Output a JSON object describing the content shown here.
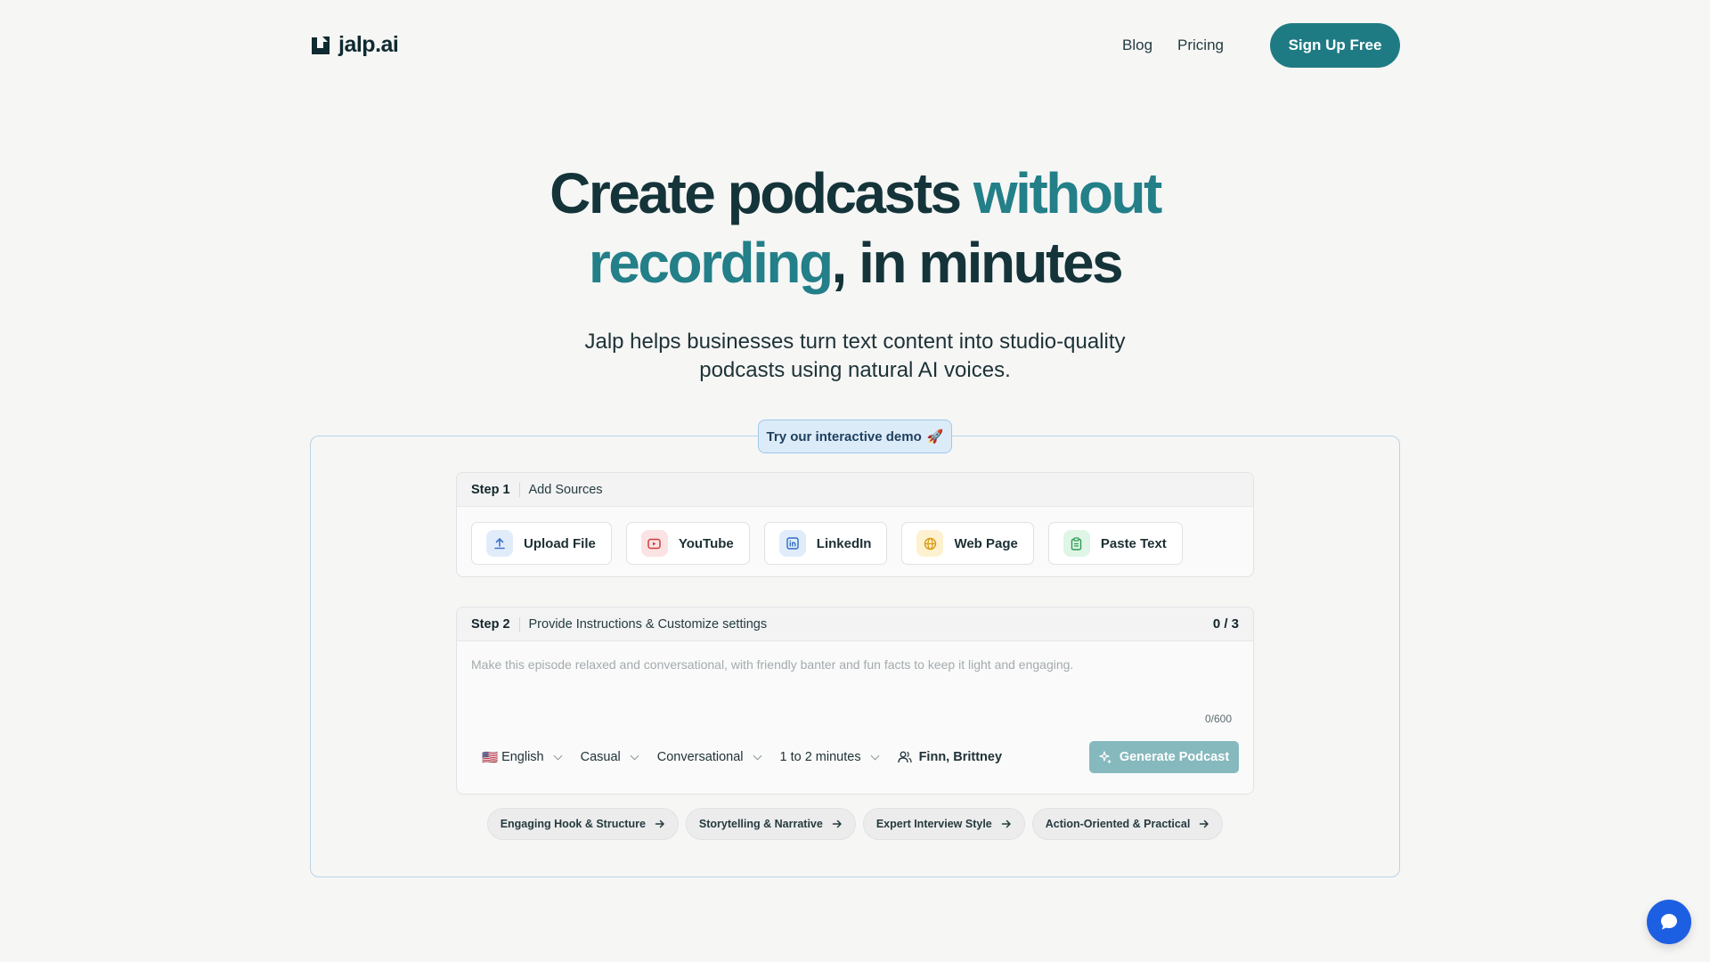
{
  "brand": {
    "name": "jalp.ai"
  },
  "nav": {
    "blog": "Blog",
    "pricing": "Pricing",
    "signup": "Sign Up Free"
  },
  "hero": {
    "title_part1": "Create podcasts ",
    "title_accent_line1": "without",
    "title_accent_line2": "recording",
    "title_part2": ", in minutes",
    "subtitle": "Jalp helps businesses turn text content into studio-quality podcasts using natural AI voices."
  },
  "demo": {
    "label": "Try our interactive demo",
    "emoji": "🚀"
  },
  "step1": {
    "num": "Step 1",
    "title": "Add Sources",
    "sources": [
      {
        "label": "Upload File",
        "icon": "upload-icon",
        "bg": "#e1ecfb",
        "color": "#3f74c9"
      },
      {
        "label": "YouTube",
        "icon": "youtube-icon",
        "bg": "#fbe3e3",
        "color": "#d23b3b"
      },
      {
        "label": "LinkedIn",
        "icon": "linkedin-icon",
        "bg": "#e1ecfb",
        "color": "#2f6bbf"
      },
      {
        "label": "Web Page",
        "icon": "globe-icon",
        "bg": "#fdf1cf",
        "color": "#d89a12"
      },
      {
        "label": "Paste Text",
        "icon": "clipboard-icon",
        "bg": "#dff5e6",
        "color": "#2f9a55"
      }
    ]
  },
  "step2": {
    "num": "Step 2",
    "title": "Provide Instructions & Customize settings",
    "count": "0 / 3",
    "placeholder": "Make this episode relaxed and conversational, with friendly banter and fun facts to keep it light and engaging.",
    "char_count": "0/600",
    "language": {
      "flag": "🇺🇸",
      "label": "English"
    },
    "tone": "Casual",
    "style": "Conversational",
    "length": "1 to 2 minutes",
    "voices": "Finn, Brittney",
    "generate": "Generate Podcast"
  },
  "prompts": [
    "Engaging Hook & Structure",
    "Storytelling & Narrative",
    "Expert Interview Style",
    "Action-Oriented & Practical"
  ],
  "colors": {
    "accent": "#1f7b83",
    "chat": "#1d5fe2"
  }
}
